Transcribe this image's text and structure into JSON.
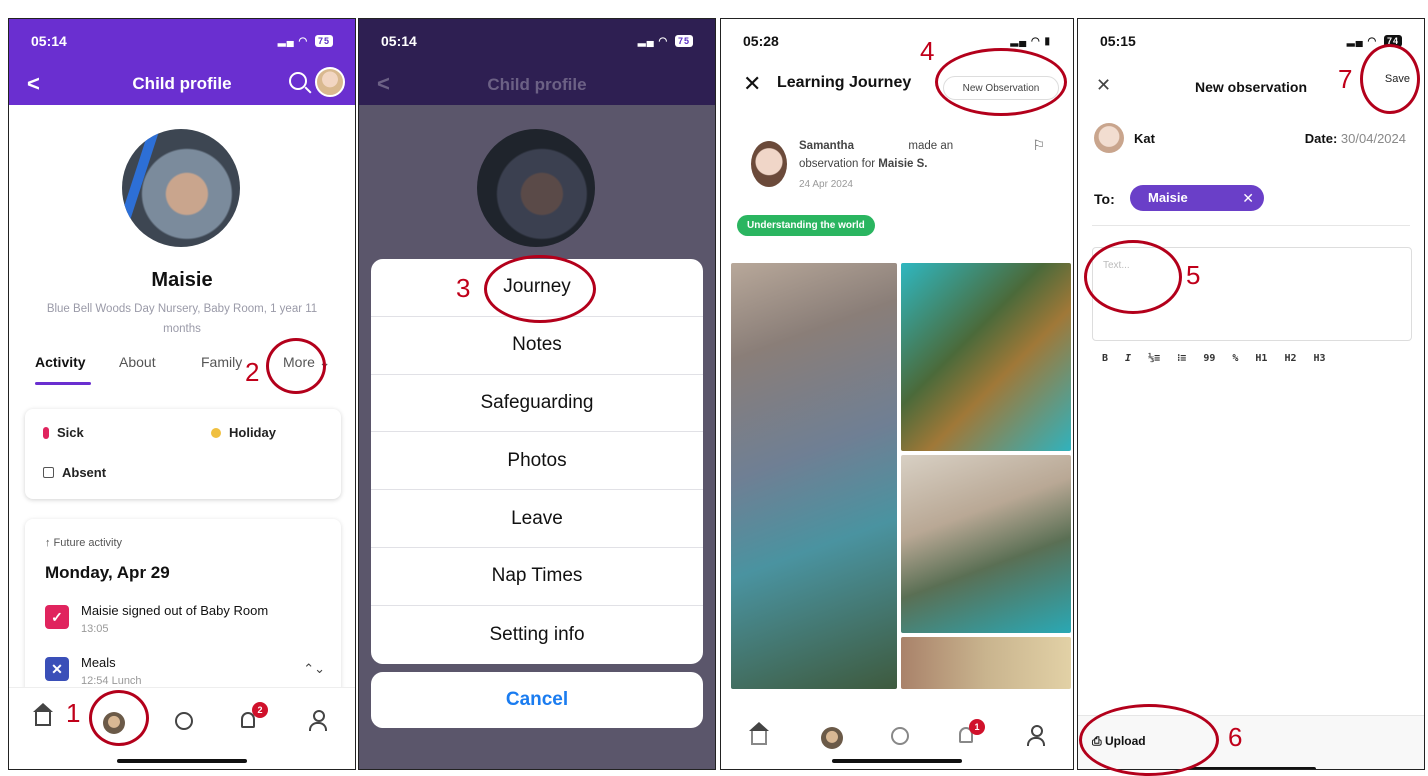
{
  "panel1": {
    "time": "05:14",
    "battery": "75",
    "title": "Child profile",
    "child_name": "Maisie",
    "child_sub": "Blue Bell Woods Day Nursery, Baby Room, 1 year 11 months",
    "tabs": [
      "Activity",
      "About",
      "Family",
      "More"
    ],
    "status_options": [
      "Sick",
      "Holiday",
      "Absent"
    ],
    "future_label": "↑ Future activity",
    "date_heading": "Monday, Apr 29",
    "activities": [
      {
        "title": "Maisie signed out of Baby Room",
        "time": "13:05"
      },
      {
        "title": "Meals",
        "time": "12:54 Lunch"
      }
    ],
    "notification_count": "2",
    "accent": "#6a2fd0"
  },
  "panel2": {
    "time": "05:14",
    "battery": "75",
    "title": "Child profile",
    "menu_items": [
      "Journey",
      "Notes",
      "Safeguarding",
      "Photos",
      "Leave",
      "Nap Times",
      "Setting info"
    ],
    "cancel": "Cancel"
  },
  "panel3": {
    "time": "05:28",
    "title": "Learning Journey",
    "new_observation": "New Observation",
    "author": "Samantha",
    "obs_mid": "made an observation for",
    "obs_child": "Maisie S.",
    "obs_date": "24 Apr 2024",
    "tag": "Understanding the world",
    "notification_count": "1"
  },
  "panel4": {
    "time": "05:15",
    "battery": "74",
    "title": "New observation",
    "save": "Save",
    "user": "Kat",
    "date_label": "Date:",
    "date_value": "30/04/2024",
    "to_label": "To:",
    "recipient": "Maisie",
    "placeholder": "Text...",
    "toolbar": [
      "B",
      "I",
      "⅓≡",
      "⁝≡",
      "99",
      "%",
      "H1",
      "H2",
      "H3"
    ],
    "upload": "Upload"
  },
  "annotations": [
    "1",
    "2",
    "3",
    "4",
    "5",
    "6",
    "7"
  ],
  "annotation_color": "#c0001a"
}
